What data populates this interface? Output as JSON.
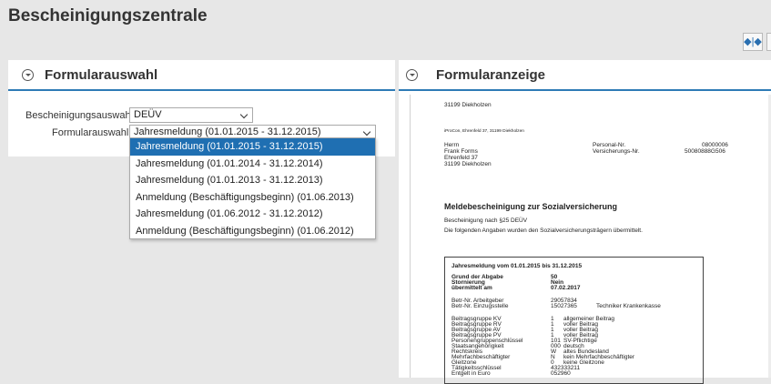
{
  "app": {
    "title": "Bescheinigungszentrale",
    "toolbar_button_icon": "◆|◆"
  },
  "left": {
    "panel_title": "Formularauswahl",
    "fields": {
      "bescheinigung_label": "Bescheinigungsauswahl:",
      "bescheinigung_value": "DEÜV",
      "formular_label": "Formularauswahl:",
      "formular_value": "Jahresmeldung (01.01.2015 - 31.12.2015)"
    },
    "dropdown_options": [
      "Jahresmeldung (01.01.2015 - 31.12.2015)",
      "Jahresmeldung (01.01.2014 - 31.12.2014)",
      "Jahresmeldung (01.01.2013 - 31.12.2013)",
      "Anmeldung (Beschäftigungsbeginn) (01.06.2013)",
      "Jahresmeldung (01.06.2012 - 31.12.2012)",
      "Anmeldung (Beschäftigungsbeginn) (01.06.2012)"
    ],
    "selected_index": 0
  },
  "right": {
    "panel_title": "Formularanzeige",
    "document": {
      "top_line": "31199 Diekholzen",
      "sender_line": "iProCon, Ehrenfeld 37, 31199 Diekholzen",
      "address": [
        "Herrn",
        "Frank Forms",
        "Ehrenfeld 37",
        "31199 Diekholzen"
      ],
      "personal_nr_label": "Personal-Nr.",
      "personal_nr_value": "08000006",
      "versicherungs_nr_label": "Versicherungs-Nr.",
      "versicherungs_nr_value": "50080888G506",
      "heading": "Meldebescheinigung zur Sozialversicherung",
      "line1": "Bescheinigung nach §25 DEÜV",
      "line2": "Die folgenden Angaben wurden den Sozialversicherungsträgern übermittelt.",
      "box_title": "Jahresmeldung vom 01.01.2015 bis 31.12.2015",
      "group1": [
        {
          "label": "Grund der Abgabe",
          "value": "50"
        },
        {
          "label": "Stornierung",
          "value": "Nein"
        },
        {
          "label": "übermittelt am",
          "value": "07.02.2017"
        }
      ],
      "group2": [
        {
          "label": "Betr-Nr. Arbeitgeber",
          "value": "29057834"
        },
        {
          "label": "Betr-Nr. Einzugsstelle",
          "value": "15027365",
          "extra": "Techniker Krankenkasse"
        }
      ],
      "group3": [
        {
          "label": "Beitragsgruppe KV",
          "value": "1",
          "extra": "allgemeiner Beitrag"
        },
        {
          "label": "Beitragsgruppe RV",
          "value": "1",
          "extra": "voller Beitrag"
        },
        {
          "label": "Beitragsgruppe AV",
          "value": "1",
          "extra": "voller Beitrag"
        },
        {
          "label": "Beitragsgruppe PV",
          "value": "1",
          "extra": "voller Beitrag"
        },
        {
          "label": "Personengruppenschlüssel",
          "value": "101",
          "extra": "SV-Pflichtige"
        },
        {
          "label": "Staatsangehörigkeit",
          "value": "000",
          "extra": "deutsch"
        },
        {
          "label": "Rechtskreis",
          "value": "W",
          "extra": "altes Bundesland"
        },
        {
          "label": "Mehrfachbeschäftigter",
          "value": "N",
          "extra": "kein Mehrfachbeschäftigter"
        },
        {
          "label": "Gleitzone",
          "value": "0",
          "extra": "keine Gleitzone"
        },
        {
          "label": "Tätigkeitsschlüssel",
          "value": "432333211",
          "extra": ""
        },
        {
          "label": "Entgelt in Euro",
          "value": "052960",
          "extra": ""
        }
      ]
    }
  }
}
